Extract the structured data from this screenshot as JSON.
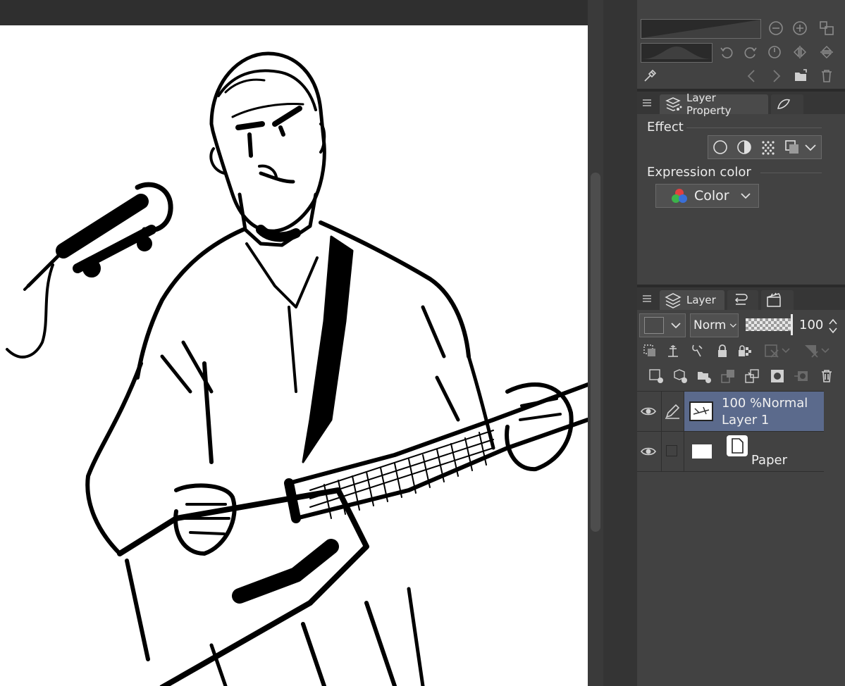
{
  "layer_property": {
    "tab_label": "Layer Property",
    "effect_title": "Effect",
    "expression_color_title": "Expression color",
    "expression_color_value": "Color"
  },
  "layer_panel": {
    "tab_label": "Layer",
    "blend_mode_value": "Norm",
    "opacity_value": "100",
    "layers": [
      {
        "opacity_mode": "100 %Normal",
        "name": "Layer 1",
        "selected": true
      },
      {
        "name": "Paper",
        "selected": false
      }
    ]
  },
  "colors": {
    "panel_bg": "#424242",
    "selected_layer": "#5b6a8c",
    "canvas": "#ffffff"
  }
}
